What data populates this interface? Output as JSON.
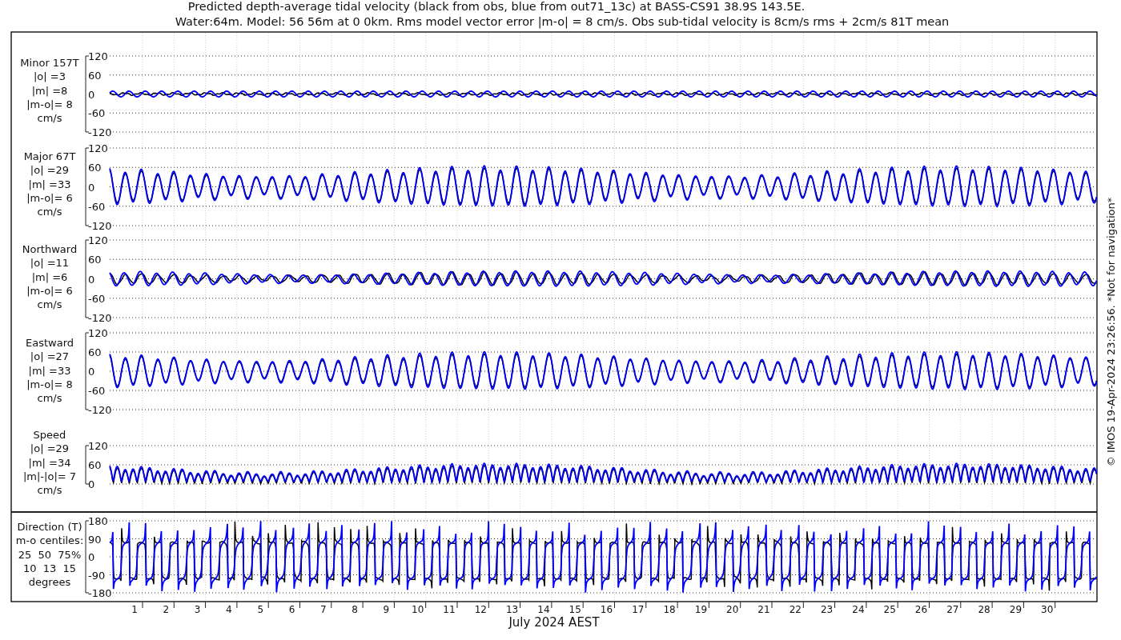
{
  "title_lines": [
    "Predicted depth-average tidal velocity (black from obs, blue from out71_13c) at BASS-CS91 38.9S 143.5E.",
    "Water:64m. Model: 56 56m at 0 0km. Rms model vector error |m-o| = 8 cm/s. Obs sub-tidal velocity is 8cm/s rms + 2cm/s 81T mean"
  ],
  "panels": [
    {
      "kind": "minor",
      "label_lines": [
        "Minor 157T",
        "|o| =3",
        "|m| =8",
        "|m-o|= 8",
        "cm/s"
      ],
      "yticks": [
        "120",
        "60",
        "0",
        "-60",
        "-120"
      ]
    },
    {
      "kind": "major",
      "label_lines": [
        "Major 67T",
        "|o| =29",
        "|m| =33",
        "|m-o|= 6",
        "cm/s"
      ],
      "yticks": [
        "120",
        "60",
        "0",
        "-60",
        "-120"
      ]
    },
    {
      "kind": "north",
      "label_lines": [
        "Northward",
        "|o| =11",
        "|m| =6",
        "|m-o|= 6",
        "cm/s"
      ],
      "yticks": [
        "120",
        "60",
        "0",
        "-60",
        "-120"
      ]
    },
    {
      "kind": "east",
      "label_lines": [
        "Eastward",
        "|o| =27",
        "|m| =33",
        "|m-o|= 8",
        "cm/s"
      ],
      "yticks": [
        "120",
        "60",
        "0",
        "-60",
        "-120"
      ]
    },
    {
      "kind": "speed",
      "label_lines": [
        "Speed",
        "|o| =29",
        "|m| =34",
        "|m|-|o|= 7",
        "cm/s"
      ],
      "yticks": [
        "120",
        "60",
        "0"
      ]
    },
    {
      "kind": "direction",
      "label_lines": [
        "Direction (T)",
        "m-o centiles:",
        "25  50  75%",
        "10  13  15",
        "degrees"
      ],
      "yticks": [
        "180",
        "90",
        "0",
        "-90",
        "-180"
      ]
    }
  ],
  "days": [
    "1",
    "2",
    "3",
    "4",
    "5",
    "6",
    "7",
    "8",
    "9",
    "10",
    "11",
    "12",
    "13",
    "14",
    "15",
    "16",
    "17",
    "18",
    "19",
    "20",
    "21",
    "22",
    "23",
    "24",
    "25",
    "26",
    "27",
    "28",
    "29",
    "30"
  ],
  "xlabel": "July 2024 AEST",
  "side_note": "© IMOS 19-Apr-2024 23:26:56. *Not for navigation*"
}
